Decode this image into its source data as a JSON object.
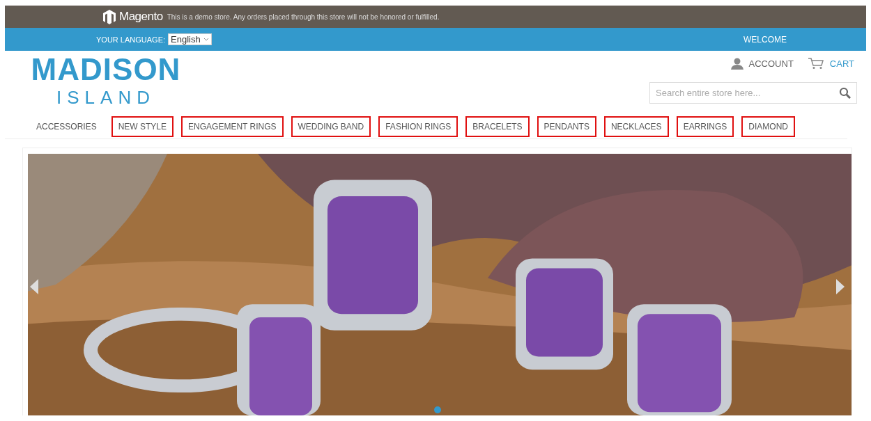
{
  "notice": {
    "brand": "Magento",
    "text": "This is a demo store. Any orders placed through this store will not be honored or fulfilled."
  },
  "header_bar": {
    "language_label": "YOUR LANGUAGE:",
    "language": "English",
    "welcome": "WELCOME"
  },
  "logo": {
    "line_1": "MADISON",
    "line_2": "ISLAND"
  },
  "account": {
    "label": "ACCOUNT"
  },
  "cart": {
    "label": "CART"
  },
  "search": {
    "placeholder": "Search entire store here..."
  },
  "nav": [
    {
      "label": "ACCESSORIES",
      "highlighted": false
    },
    {
      "label": "NEW STYLE",
      "highlighted": true
    },
    {
      "label": "ENGAGEMENT RINGS",
      "highlighted": true
    },
    {
      "label": "WEDDING BAND",
      "highlighted": true
    },
    {
      "label": "FASHION RINGS",
      "highlighted": true
    },
    {
      "label": "BRACELETS",
      "highlighted": true
    },
    {
      "label": "PENDANTS",
      "highlighted": true
    },
    {
      "label": "NECKLACES",
      "highlighted": true
    },
    {
      "label": "EARRINGS",
      "highlighted": true
    },
    {
      "label": "DIAMOND",
      "highlighted": true
    }
  ]
}
